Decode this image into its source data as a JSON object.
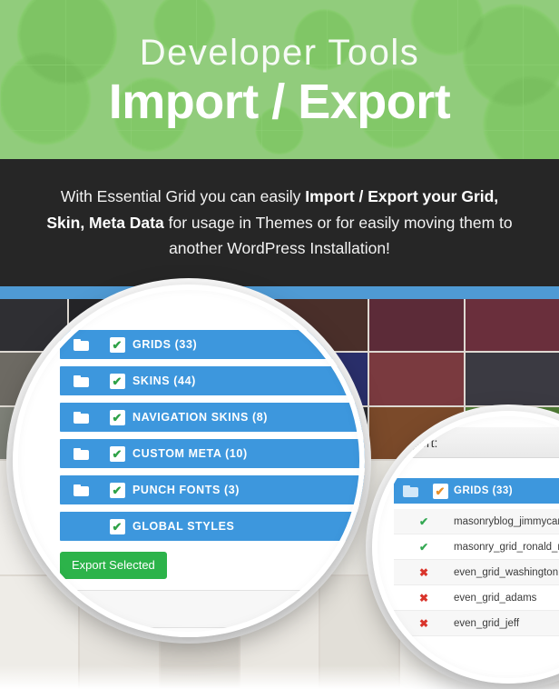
{
  "hero": {
    "eyebrow": "Developer Tools",
    "title": "Import / Export",
    "bg_color": "#7bc161"
  },
  "description": {
    "part1": "With Essential Grid you can easily ",
    "bold1": "Import / Export your Grid, Skin, Meta Data",
    "part2": " for usage in Themes or for easily moving them to another WordPress Installation!",
    "bg_color": "#262626"
  },
  "export_panel": {
    "accent_row_color": "#3d97dd",
    "checkbox_check_color": "#2fa247",
    "rows": [
      {
        "label": "GRIDS",
        "count": "(33)",
        "checked": true,
        "has_folder": true
      },
      {
        "label": "SKINS",
        "count": "(44)",
        "checked": true,
        "has_folder": true
      },
      {
        "label": "NAVIGATION SKINS",
        "count": "(8)",
        "checked": true,
        "has_folder": true
      },
      {
        "label": "CUSTOM META",
        "count": "(10)",
        "checked": true,
        "has_folder": true
      },
      {
        "label": "PUNCH FONTS",
        "count": "(3)",
        "checked": true,
        "has_folder": true
      },
      {
        "label": "GLOBAL STYLES",
        "count": "",
        "checked": true,
        "has_folder": false
      }
    ],
    "export_button_label": "Export Selected",
    "export_button_color": "#2cb34a"
  },
  "detail_panel": {
    "title": "Export:",
    "group": {
      "label": "GRIDS",
      "count": "(33)",
      "checked": true,
      "check_color": "#e8912a"
    },
    "items": [
      {
        "name": "masonryblog_jimmycarter",
        "state": "included",
        "mark": "✔"
      },
      {
        "name": "masonry_grid_ronald_reag",
        "state": "included",
        "mark": "✔"
      },
      {
        "name": "even_grid_washington",
        "state": "excluded",
        "mark": "✖"
      },
      {
        "name": "even_grid_adams",
        "state": "excluded",
        "mark": "✖"
      },
      {
        "name": "even_grid_jeff",
        "state": "excluded",
        "mark": "✖"
      }
    ],
    "include_color": "#33a852",
    "exclude_color": "#d9342b"
  }
}
